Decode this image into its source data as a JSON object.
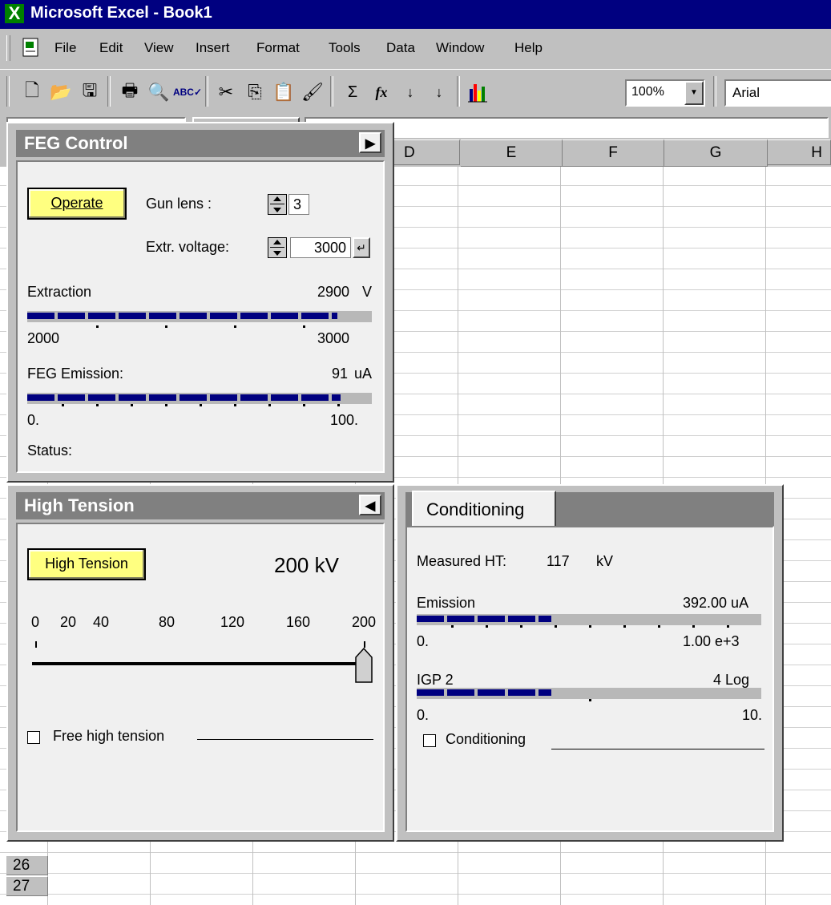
{
  "window": {
    "title": "Microsoft Excel - Book1",
    "app_icon": "excel-icon"
  },
  "menu": [
    "File",
    "Edit",
    "View",
    "Insert",
    "Format",
    "Tools",
    "Data",
    "Window",
    "Help"
  ],
  "toolbar": {
    "buttons": [
      "new-icon",
      "open-icon",
      "save-icon",
      "print-icon",
      "print-preview-icon",
      "spelling-icon",
      "cut-icon",
      "copy-icon",
      "paste-icon",
      "format-painter-icon",
      "autosum-icon",
      "function-icon",
      "sort-ascending-icon",
      "sort-descending-icon",
      "chart-wizard-icon"
    ],
    "zoom": "100%",
    "font": "Arial"
  },
  "sheet": {
    "columns": [
      "D",
      "E",
      "F",
      "G",
      "H"
    ],
    "rows": [
      "26",
      "27"
    ]
  },
  "feg_control": {
    "title": "FEG Control",
    "operate_label": "Operate",
    "gun_lens_label": "Gun lens :",
    "gun_lens_value": "3",
    "extr_voltage_label": "Extr. voltage:",
    "extr_voltage_value": "3000",
    "extraction_label": "Extraction",
    "extraction_value": "2900",
    "extraction_unit": "V",
    "extraction_min": "2000",
    "extraction_max": "3000",
    "extraction_fraction": 0.9,
    "emission_label": "FEG Emission:",
    "emission_value": "91",
    "emission_unit": "uA",
    "emission_min": "0.",
    "emission_max": "100.",
    "emission_fraction": 0.91,
    "status_label": "Status:"
  },
  "high_tension": {
    "title": "High Tension",
    "button_label": "High Tension",
    "value": "200 kV",
    "scale": [
      "0",
      "20",
      "40",
      "80",
      "120",
      "160",
      "200"
    ],
    "slider_fraction": 1.0,
    "free_label": "Free high tension"
  },
  "conditioning": {
    "tab_label": "Conditioning",
    "measured_label": "Measured HT:",
    "measured_value": "117",
    "measured_unit": "kV",
    "emission_label": "Emission",
    "emission_value": "392.00 uA",
    "emission_min": "0.",
    "emission_max": "1.00 e+3",
    "emission_fraction": 0.39,
    "igp_label": "IGP 2",
    "igp_value": "4 Log",
    "igp_min": "0.",
    "igp_max": "10.",
    "igp_fraction": 0.39,
    "checkbox_label": "Conditioning"
  }
}
